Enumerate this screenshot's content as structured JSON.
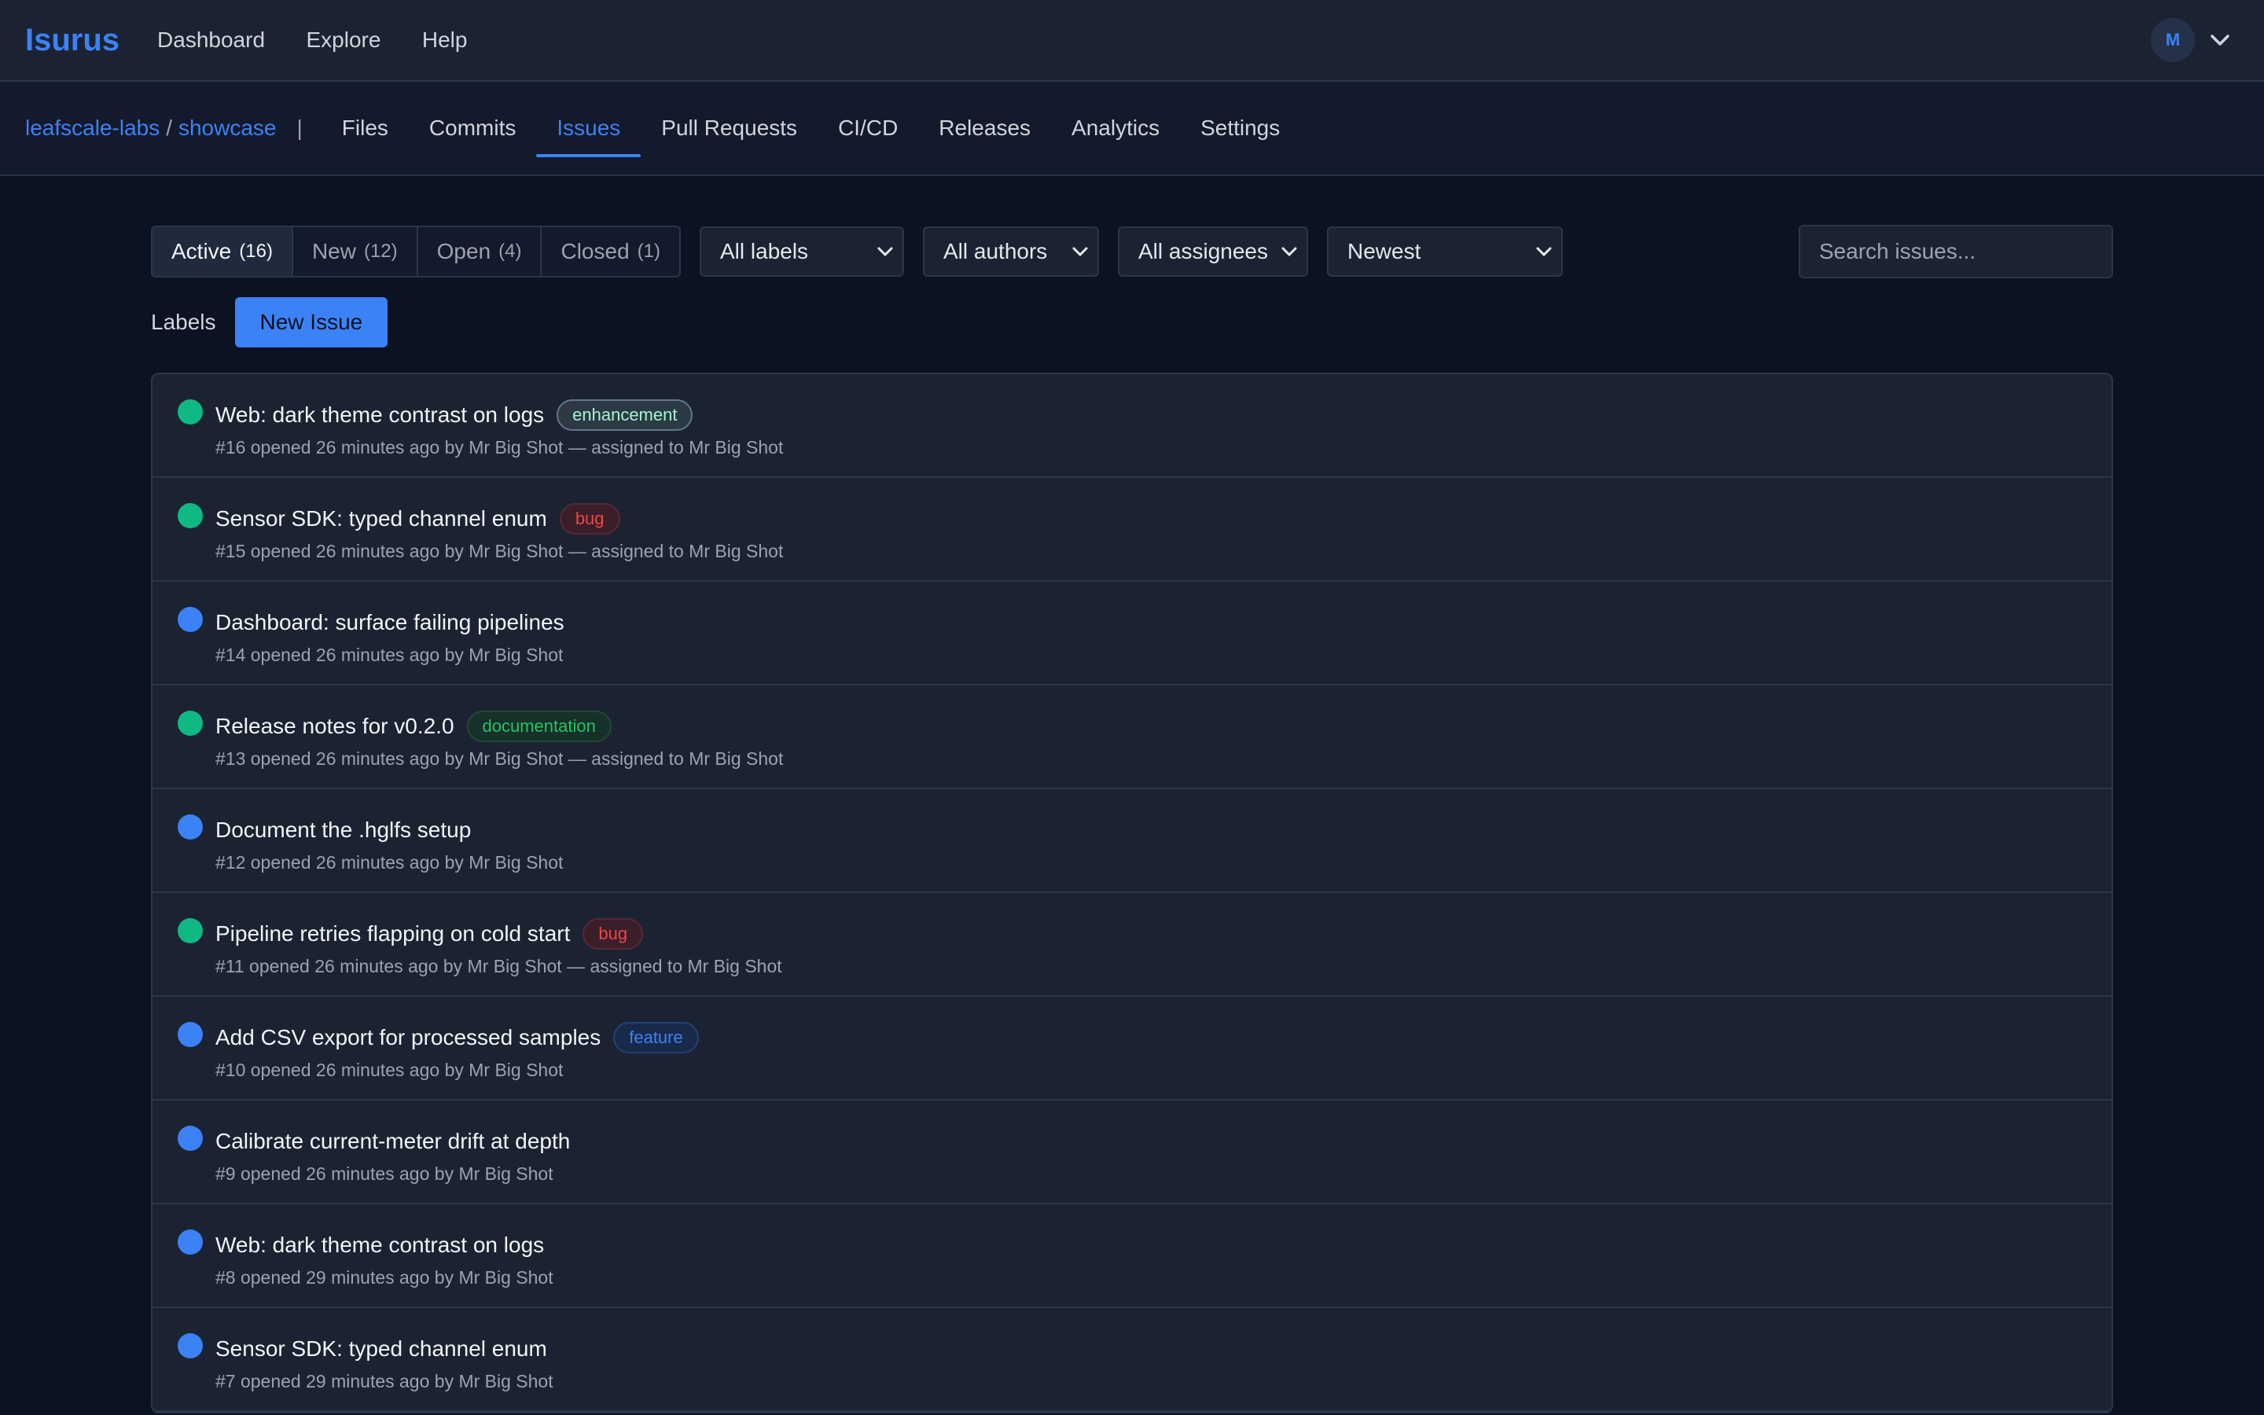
{
  "app": {
    "brand": "Isurus"
  },
  "topnav": [
    "Dashboard",
    "Explore",
    "Help"
  ],
  "user": {
    "initial": "M"
  },
  "repo": {
    "owner": "leafscale-labs",
    "separator": "/",
    "name": "showcase",
    "pipe": "|"
  },
  "repo_tabs": [
    {
      "label": "Files",
      "active": false
    },
    {
      "label": "Commits",
      "active": false
    },
    {
      "label": "Issues",
      "active": true
    },
    {
      "label": "Pull Requests",
      "active": false
    },
    {
      "label": "CI/CD",
      "active": false
    },
    {
      "label": "Releases",
      "active": false
    },
    {
      "label": "Analytics",
      "active": false
    },
    {
      "label": "Settings",
      "active": false
    }
  ],
  "status_filter": [
    {
      "label": "Active",
      "count": "(16)",
      "active": true
    },
    {
      "label": "New",
      "count": "(12)",
      "active": false
    },
    {
      "label": "Open",
      "count": "(4)",
      "active": false
    },
    {
      "label": "Closed",
      "count": "(1)",
      "active": false
    }
  ],
  "dropdowns": {
    "labels": "All labels",
    "authors": "All authors",
    "assignees": "All assignees",
    "sort": "Newest"
  },
  "search": {
    "placeholder": "Search issues..."
  },
  "actions": {
    "labels": "Labels",
    "new_issue": "New Issue"
  },
  "colors": {
    "accent": "#3b82f6",
    "status_active": "#10b981",
    "status_new": "#3b82f6",
    "badge_enhancement": "#a7f3d0",
    "badge_bug": "#ef4444",
    "badge_documentation": "#22c55e",
    "badge_feature": "#3b82f6"
  },
  "issues": [
    {
      "status": "active",
      "title": "Web: dark theme contrast on logs",
      "label": "enhancement",
      "meta": "#16 opened 26 minutes ago by Mr Big Shot — assigned to Mr Big Shot"
    },
    {
      "status": "active",
      "title": "Sensor SDK: typed channel enum",
      "label": "bug",
      "meta": "#15 opened 26 minutes ago by Mr Big Shot — assigned to Mr Big Shot"
    },
    {
      "status": "new",
      "title": "Dashboard: surface failing pipelines",
      "label": "",
      "meta": "#14 opened 26 minutes ago by Mr Big Shot"
    },
    {
      "status": "active",
      "title": "Release notes for v0.2.0",
      "label": "documentation",
      "meta": "#13 opened 26 minutes ago by Mr Big Shot — assigned to Mr Big Shot"
    },
    {
      "status": "new",
      "title": "Document the .hglfs setup",
      "label": "",
      "meta": "#12 opened 26 minutes ago by Mr Big Shot"
    },
    {
      "status": "active",
      "title": "Pipeline retries flapping on cold start",
      "label": "bug",
      "meta": "#11 opened 26 minutes ago by Mr Big Shot — assigned to Mr Big Shot"
    },
    {
      "status": "new",
      "title": "Add CSV export for processed samples",
      "label": "feature",
      "meta": "#10 opened 26 minutes ago by Mr Big Shot"
    },
    {
      "status": "new",
      "title": "Calibrate current-meter drift at depth",
      "label": "",
      "meta": "#9 opened 26 minutes ago by Mr Big Shot"
    },
    {
      "status": "new",
      "title": "Web: dark theme contrast on logs",
      "label": "",
      "meta": "#8 opened 29 minutes ago by Mr Big Shot"
    },
    {
      "status": "new",
      "title": "Sensor SDK: typed channel enum",
      "label": "",
      "meta": "#7 opened 29 minutes ago by Mr Big Shot"
    }
  ]
}
